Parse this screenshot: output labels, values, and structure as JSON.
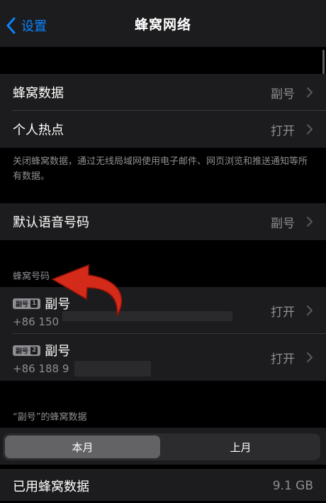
{
  "navbar": {
    "back_label": "设置",
    "title": "蜂窝网络"
  },
  "group1": {
    "rows": [
      {
        "label": "蜂窝数据",
        "value": "副号"
      },
      {
        "label": "个人热点",
        "value": "打开"
      }
    ],
    "footnote": "关闭蜂窝数据，通过无线局域网使用电子邮件、网页浏览和推送通知等所有数据。"
  },
  "voice": {
    "label": "默认语音号码",
    "value": "副号"
  },
  "cellular_numbers": {
    "header": "蜂窝号码",
    "lines": [
      {
        "badge": "副号",
        "badge_num": "1",
        "name": "副号",
        "number": "+86 150",
        "status": "打开"
      },
      {
        "badge": "副号",
        "badge_num": "2",
        "name": "副号",
        "number": "+86 188 9",
        "status": "打开"
      }
    ]
  },
  "usage": {
    "header": "“副号”的蜂窝数据",
    "tabs": [
      {
        "label": "本月",
        "active": true
      },
      {
        "label": "上月",
        "active": false
      }
    ],
    "used_label": "已用蜂窝数据",
    "used_value": "9.1 GB"
  },
  "colors": {
    "accent": "#0a84ff",
    "arrow": "#d42a1a"
  }
}
